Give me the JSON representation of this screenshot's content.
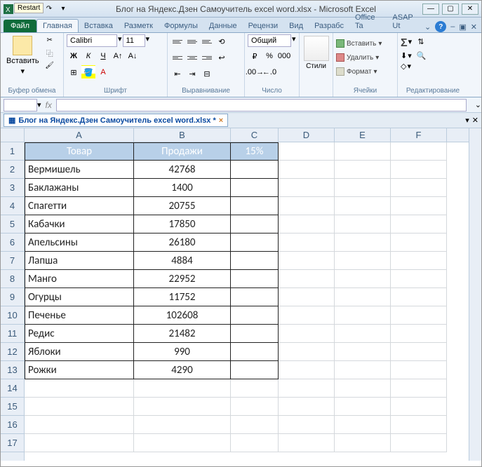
{
  "window": {
    "title": "Блог на Яндекс.Дзен Самоучитель excel word.xlsx  -  Microsoft Excel",
    "restart": "Restart"
  },
  "tabs": {
    "file": "Файл",
    "items": [
      "Главная",
      "Вставка",
      "Разметк",
      "Формулы",
      "Данные",
      "Рецензи",
      "Вид",
      "Разрабс",
      "Office Ta",
      "ASAP Ut"
    ]
  },
  "ribbon": {
    "clipboard": {
      "label": "Буфер обмена",
      "paste": "Вставить"
    },
    "font": {
      "label": "Шрифт",
      "name": "Calibri",
      "size": "11"
    },
    "align": {
      "label": "Выравнивание"
    },
    "number": {
      "label": "Число",
      "format": "Общий"
    },
    "styles": {
      "label": "Стили"
    },
    "cells": {
      "label": "Ячейки",
      "insert": "Вставить",
      "delete": "Удалить",
      "format": "Формат"
    },
    "editing": {
      "label": "Редактирование"
    }
  },
  "doc_tab": "Блог на Яндекс.Дзен Самоучитель excel word.xlsx *",
  "columns": [
    "A",
    "B",
    "C",
    "D",
    "E",
    "F"
  ],
  "rows": [
    "1",
    "2",
    "3",
    "4",
    "5",
    "6",
    "7",
    "8",
    "9",
    "10",
    "11",
    "12",
    "13",
    "14",
    "15",
    "16",
    "17"
  ],
  "table": {
    "headers": [
      "Товар",
      "Продажи",
      "15%"
    ],
    "data": [
      {
        "name": "Вермишель",
        "sales": "42768"
      },
      {
        "name": "Баклажаны",
        "sales": "1400"
      },
      {
        "name": "Спагетти",
        "sales": "20755"
      },
      {
        "name": "Кабачки",
        "sales": "17850"
      },
      {
        "name": "Апельсины",
        "sales": "26180"
      },
      {
        "name": "Лапша",
        "sales": "4884"
      },
      {
        "name": "Манго",
        "sales": "22952"
      },
      {
        "name": "Огурцы",
        "sales": "11752"
      },
      {
        "name": "Печенье",
        "sales": "102608"
      },
      {
        "name": "Редис",
        "sales": "21482"
      },
      {
        "name": "Яблоки",
        "sales": "990"
      },
      {
        "name": "Рожки",
        "sales": "4290"
      }
    ]
  }
}
